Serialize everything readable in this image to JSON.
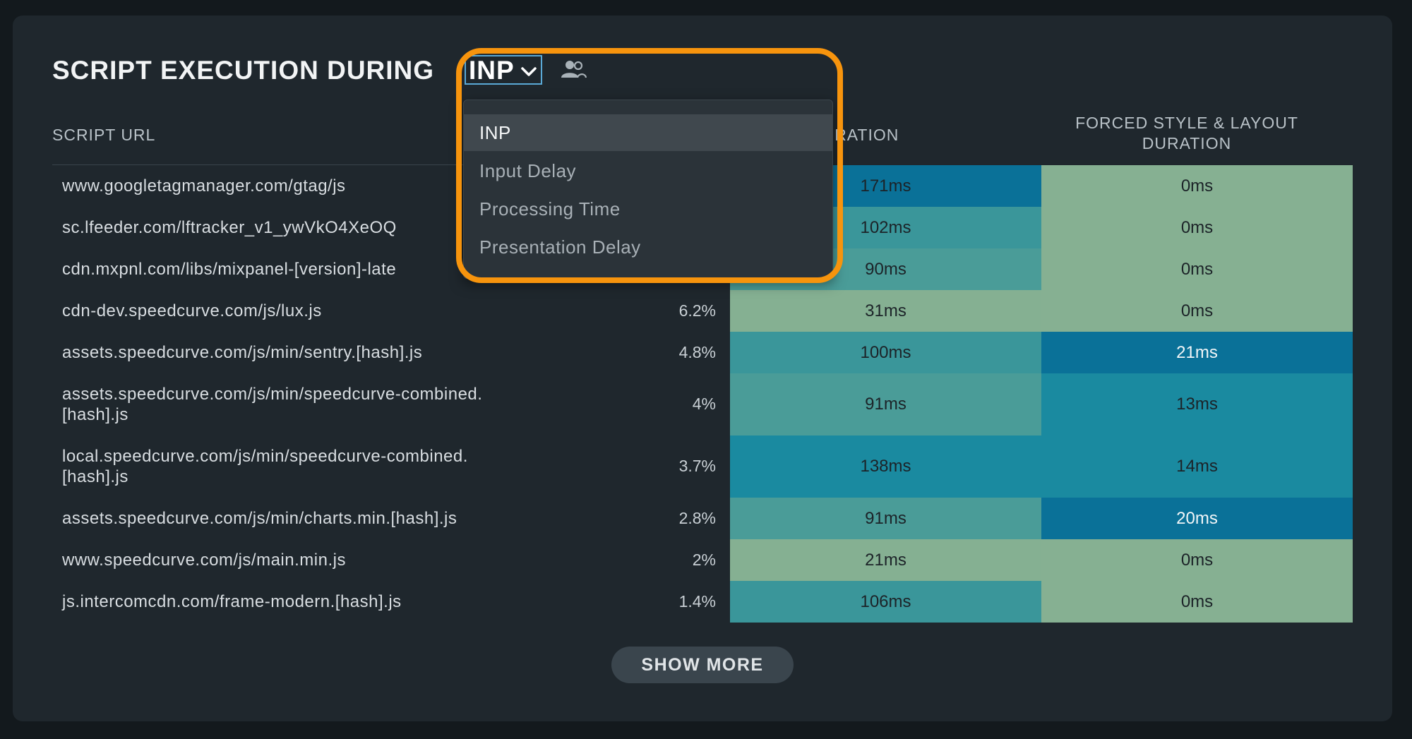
{
  "panel": {
    "title": "SCRIPT EXECUTION DURING",
    "metric_selected": "INP",
    "chevron_icon": "chevron-down-icon",
    "users_icon": "users-icon"
  },
  "table": {
    "headers": {
      "url": "SCRIPT URL",
      "duration": "L DURATION",
      "forced": "FORCED STYLE & LAYOUT\nDURATION"
    },
    "rows": [
      {
        "url": "www.googletagmanager.com/gtag/js",
        "pct": "",
        "duration": "171ms",
        "forced": "0ms"
      },
      {
        "url": "sc.lfeeder.com/lftracker_v1_ywVkO4XeOQ",
        "pct": "",
        "duration": "102ms",
        "forced": "0ms"
      },
      {
        "url": "cdn.mxpnl.com/libs/mixpanel-[version]-late",
        "pct": "",
        "duration": "90ms",
        "forced": "0ms"
      },
      {
        "url": "cdn-dev.speedcurve.com/js/lux.js",
        "pct": "6.2%",
        "duration": "31ms",
        "forced": "0ms"
      },
      {
        "url": "assets.speedcurve.com/js/min/sentry.[hash].js",
        "pct": "4.8%",
        "duration": "100ms",
        "forced": "21ms"
      },
      {
        "url": "assets.speedcurve.com/js/min/speedcurve-combined.\n[hash].js",
        "pct": "4%",
        "duration": "91ms",
        "forced": "13ms"
      },
      {
        "url": "local.speedcurve.com/js/min/speedcurve-combined.\n[hash].js",
        "pct": "3.7%",
        "duration": "138ms",
        "forced": "14ms"
      },
      {
        "url": "assets.speedcurve.com/js/min/charts.min.[hash].js",
        "pct": "2.8%",
        "duration": "91ms",
        "forced": "20ms"
      },
      {
        "url": "www.speedcurve.com/js/main.min.js",
        "pct": "2%",
        "duration": "21ms",
        "forced": "0ms"
      },
      {
        "url": "js.intercomcdn.com/frame-modern.[hash].js",
        "pct": "1.4%",
        "duration": "106ms",
        "forced": "0ms"
      }
    ],
    "colors": {
      "duration": [
        "#0a7198",
        "#3a969a",
        "#4a9c98",
        "#85b092",
        "#3a969a",
        "#4a9c98",
        "#1a8aa0",
        "#4a9c98",
        "#85b092",
        "#3a969a"
      ],
      "forced": [
        "#86b092",
        "#86b092",
        "#86b092",
        "#86b092",
        "#0a7198",
        "#1a8aa0",
        "#1a8aa0",
        "#0a7198",
        "#86b092",
        "#86b092"
      ]
    }
  },
  "dropdown": {
    "options": [
      "INP",
      "Input Delay",
      "Processing Time",
      "Presentation Delay"
    ],
    "selected_index": 0
  },
  "show_more_label": "SHOW MORE",
  "highlight_color": "#f7940d"
}
